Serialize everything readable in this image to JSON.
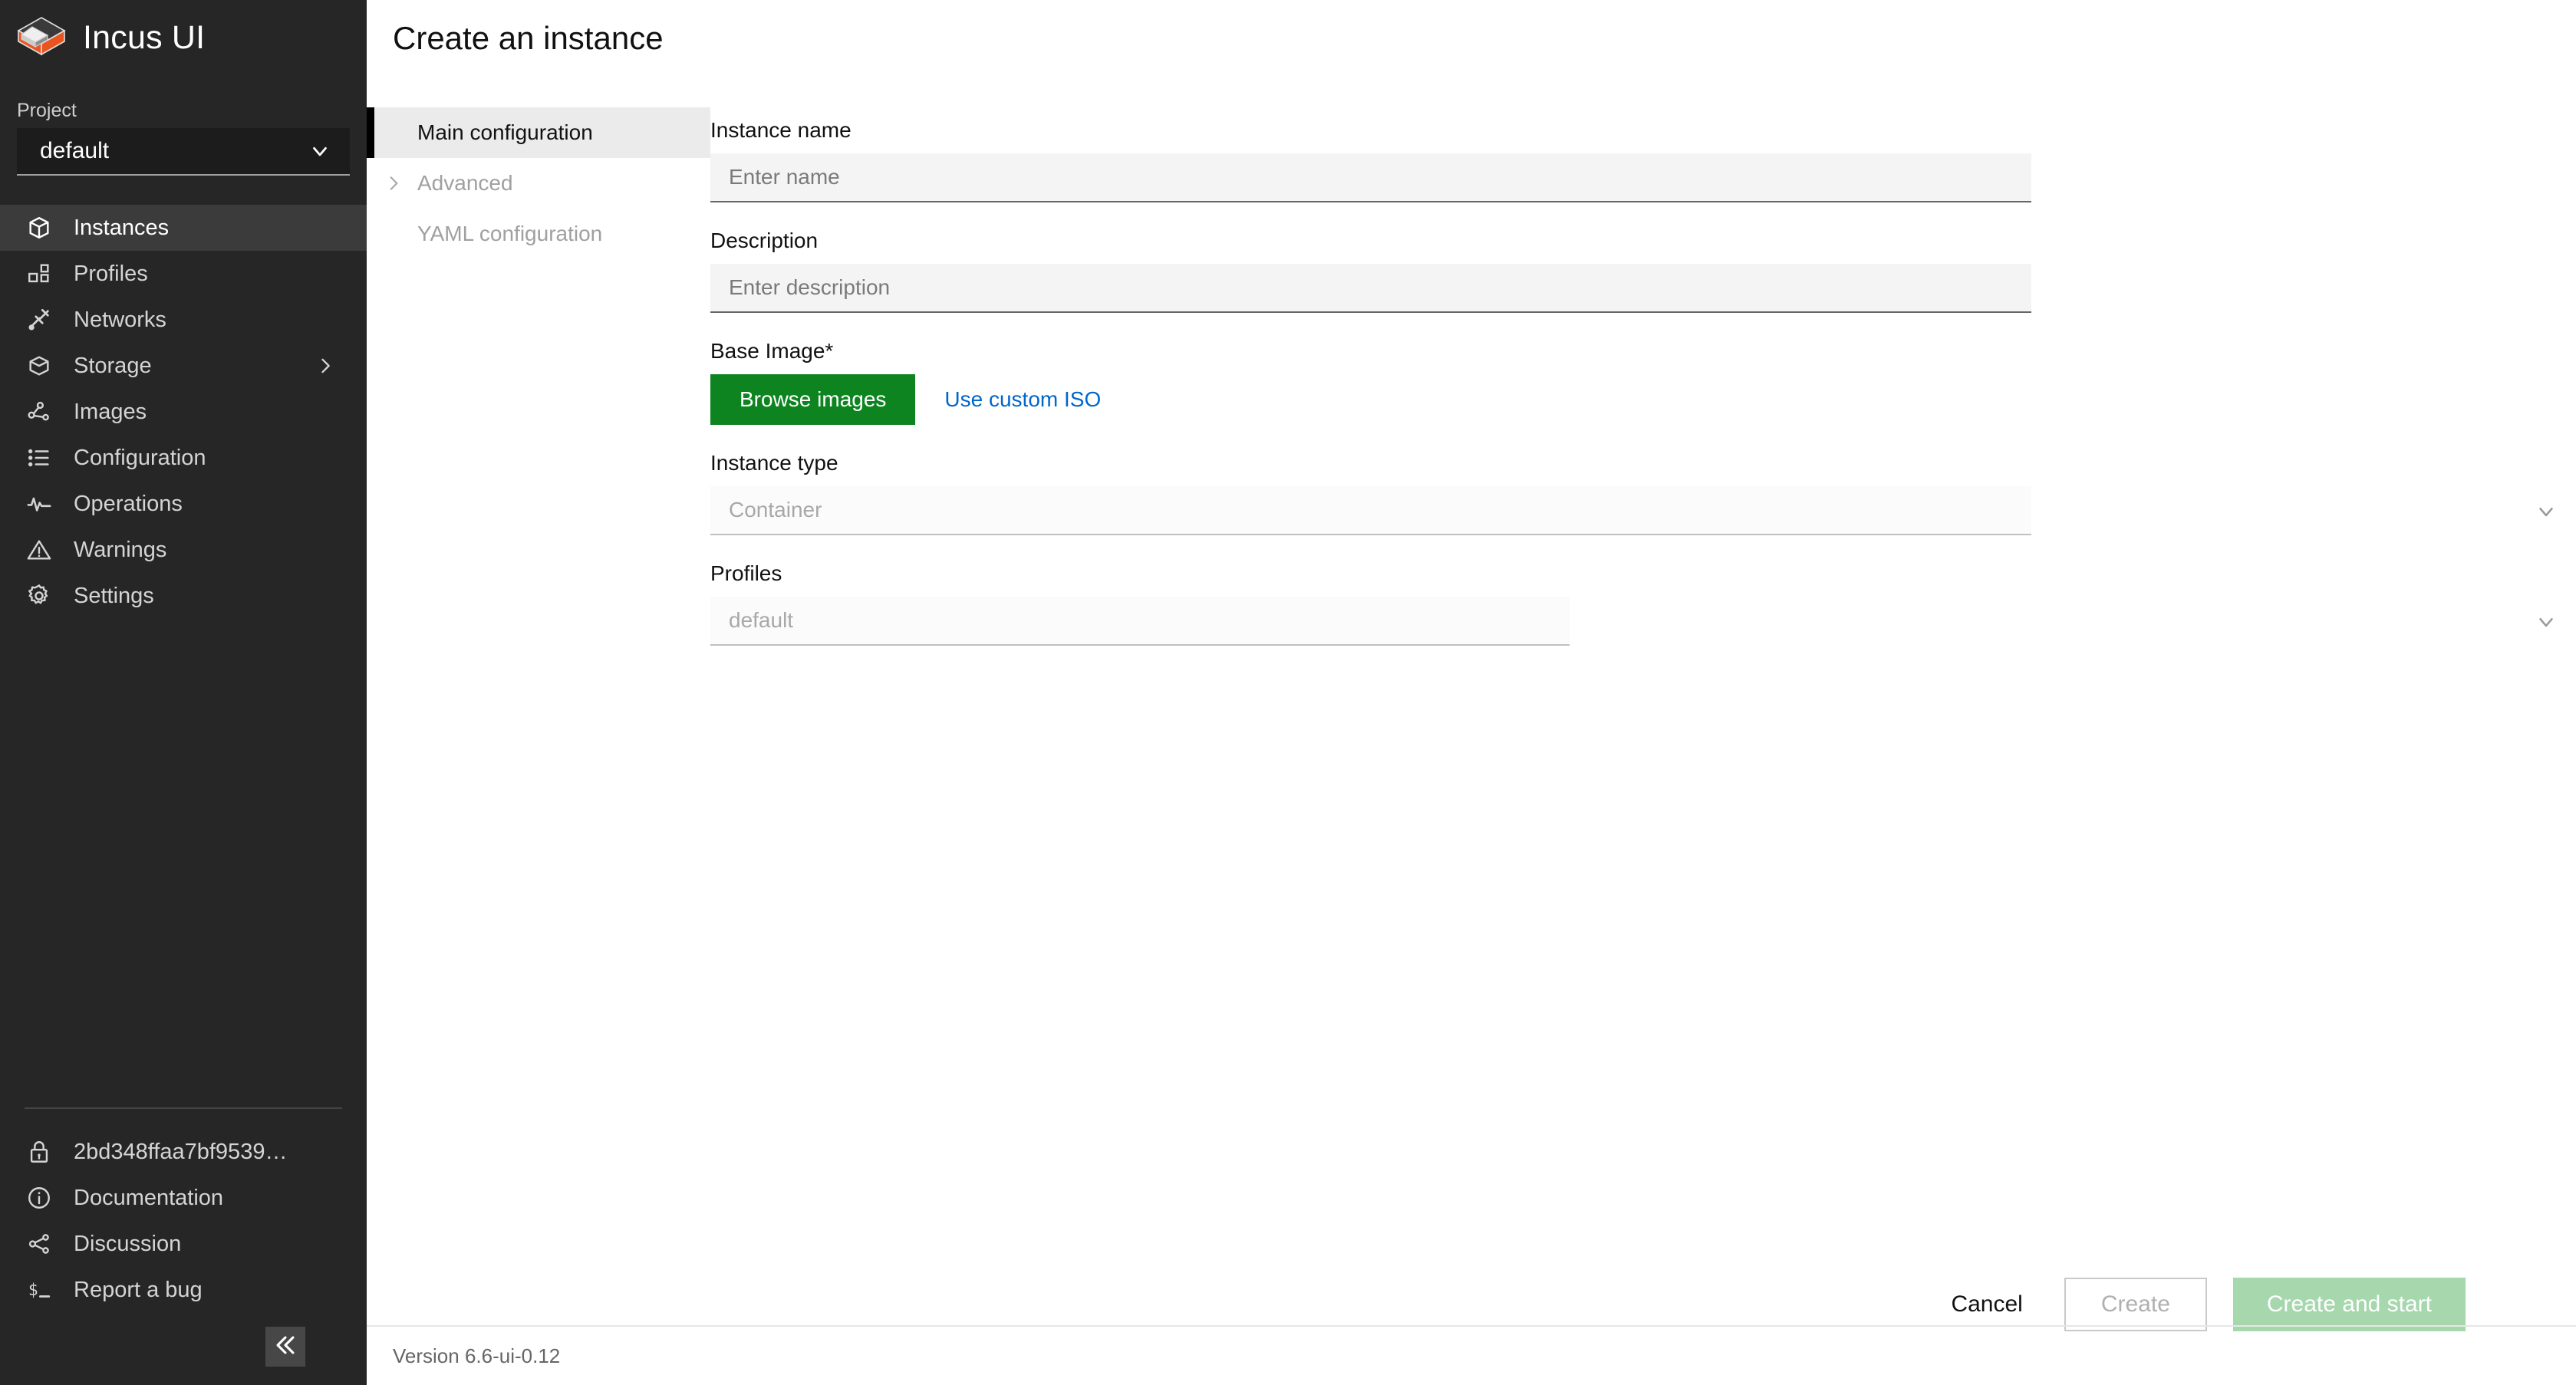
{
  "sidebar": {
    "brand": {
      "title": "Incus UI",
      "logo_icon": "incus-cube-logo"
    },
    "project": {
      "label": "Project",
      "value": "default",
      "chevron_icon": "chevron-down-icon"
    },
    "nav_items": [
      {
        "label": "Instances",
        "icon": "instances-box-icon",
        "active": true,
        "has_submenu": false
      },
      {
        "label": "Profiles",
        "icon": "profiles-grid-icon",
        "active": false,
        "has_submenu": false
      },
      {
        "label": "Networks",
        "icon": "networks-plug-icon",
        "active": false,
        "has_submenu": false
      },
      {
        "label": "Storage",
        "icon": "storage-cube-icon",
        "active": false,
        "has_submenu": true
      },
      {
        "label": "Images",
        "icon": "images-nodes-icon",
        "active": false,
        "has_submenu": false
      },
      {
        "label": "Configuration",
        "icon": "configuration-list-icon",
        "active": false,
        "has_submenu": false
      },
      {
        "label": "Operations",
        "icon": "operations-pulse-icon",
        "active": false,
        "has_submenu": false
      },
      {
        "label": "Warnings",
        "icon": "warning-triangle-icon",
        "active": false,
        "has_submenu": false
      },
      {
        "label": "Settings",
        "icon": "gear-icon",
        "active": false,
        "has_submenu": false
      }
    ],
    "bottom_items": [
      {
        "label": "2bd348ffaa7bf9539…",
        "icon": "lock-icon"
      },
      {
        "label": "Documentation",
        "icon": "info-circle-icon"
      },
      {
        "label": "Discussion",
        "icon": "share-nodes-icon"
      },
      {
        "label": "Report a bug",
        "icon": "terminal-prompt-icon"
      }
    ],
    "collapse_icon": "double-chevron-left-icon"
  },
  "header": {
    "title": "Create an instance"
  },
  "tabs": [
    {
      "label": "Main configuration",
      "active": true,
      "muted": false,
      "expandable": false
    },
    {
      "label": "Advanced",
      "active": false,
      "muted": true,
      "expandable": true
    },
    {
      "label": "YAML configuration",
      "active": false,
      "muted": true,
      "expandable": false
    }
  ],
  "form": {
    "instance_name": {
      "label": "Instance name",
      "placeholder": "Enter name",
      "value": ""
    },
    "description": {
      "label": "Description",
      "placeholder": "Enter description",
      "value": ""
    },
    "base_image": {
      "label": "Base Image*",
      "browse_button": "Browse images",
      "custom_iso_link": "Use custom ISO"
    },
    "instance_type": {
      "label": "Instance type",
      "value": "Container",
      "chevron_icon": "chevron-down-icon"
    },
    "profiles": {
      "label": "Profiles",
      "value": "default",
      "chevron_icon": "chevron-down-icon"
    }
  },
  "footer": {
    "cancel_label": "Cancel",
    "create_label": "Create",
    "create_start_label": "Create and start"
  },
  "status": {
    "version": "Version 6.6-ui-0.12"
  },
  "colors": {
    "sidebar_bg": "#262626",
    "accent_green": "#0e8420",
    "green_disabled": "#a6d7ad",
    "link_blue": "#0066cc",
    "logo_orange": "#e95420"
  }
}
